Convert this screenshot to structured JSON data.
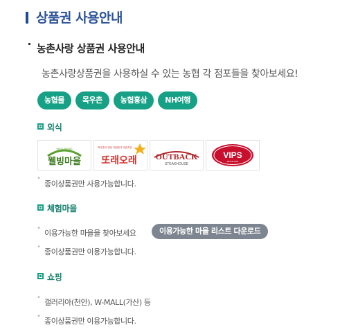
{
  "page": {
    "title": "상품권 사용안내"
  },
  "section": {
    "subtitle": "농촌사랑 상품권 사용안내",
    "description": "농촌사랑상품권을 사용하실 수 있는 농협 각 점포들을 찾아보세요!"
  },
  "tabs": [
    {
      "label": "농협몰"
    },
    {
      "label": "목우촌"
    },
    {
      "label": "농협홍삼"
    },
    {
      "label": "NH여행"
    }
  ],
  "dining": {
    "heading": "외식",
    "logos": [
      {
        "name": "wellbeing-maeul",
        "top_text": "WELLBEING",
        "text": "웰빙마을"
      },
      {
        "name": "ttoraeorae",
        "top_text": "목우촌이 만든 대한민국 대표치킨",
        "text": "또래오래"
      },
      {
        "name": "outback",
        "text": "OUTBACK",
        "sub": "STEAKHOUSE"
      },
      {
        "name": "vips",
        "text": "VIPS",
        "sub": "SINCE 1997"
      }
    ],
    "note": "종이상품권만 사용가능합니다."
  },
  "experience": {
    "heading": "체험마을",
    "note1": "이용가능한 마을을 찾아보세요",
    "download_label": "이용가능한 마을 리스트 다운로드",
    "note2": "종이상품권만 이용가능합니다."
  },
  "shopping": {
    "heading": "쇼핑",
    "note1": "갤러리아(천안), W-MALL(가산) 등",
    "note2": "종이상품권만 이용가능합니다."
  },
  "colors": {
    "title": "#2b5299",
    "accent_green": "#16a085",
    "button_gray": "#7d8690"
  }
}
